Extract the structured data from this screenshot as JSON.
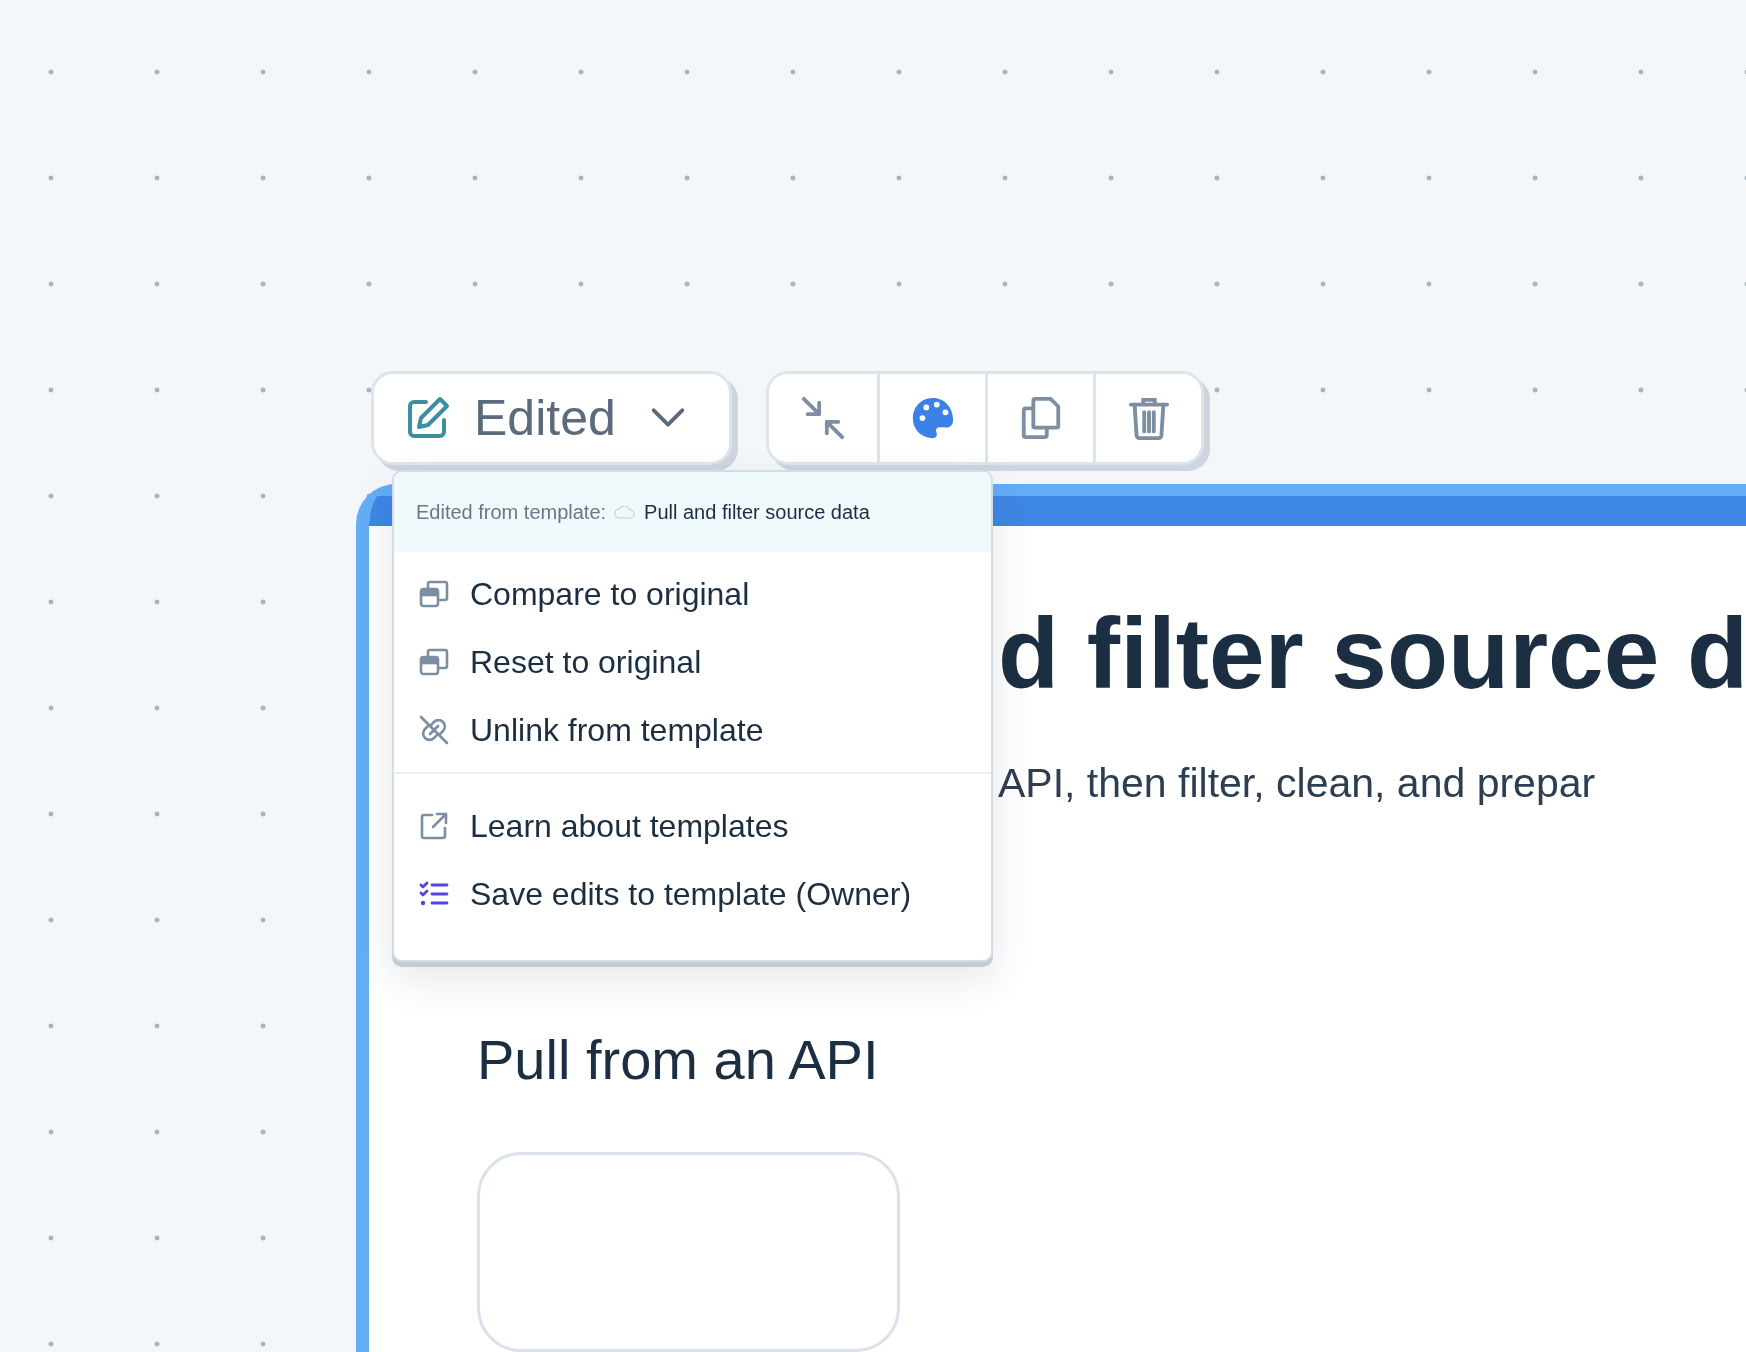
{
  "status_button": {
    "label": "Edited"
  },
  "menu": {
    "header_label": "Edited from template:",
    "header_template": "Pull and filter source data",
    "sections": [
      {
        "items": [
          {
            "kind": "compare",
            "label": "Compare to original"
          },
          {
            "kind": "reset",
            "label": "Reset to original"
          },
          {
            "kind": "unlink",
            "label": "Unlink from template"
          }
        ]
      },
      {
        "items": [
          {
            "kind": "external",
            "label": "Learn about templates"
          },
          {
            "kind": "checklist",
            "label": "Save edits to template (Owner)"
          }
        ]
      }
    ]
  },
  "document": {
    "title": "d filter source d",
    "subtitle": "API, then filter, clean, and prepar",
    "sections": [
      {
        "heading": "Pull from an API"
      }
    ]
  }
}
